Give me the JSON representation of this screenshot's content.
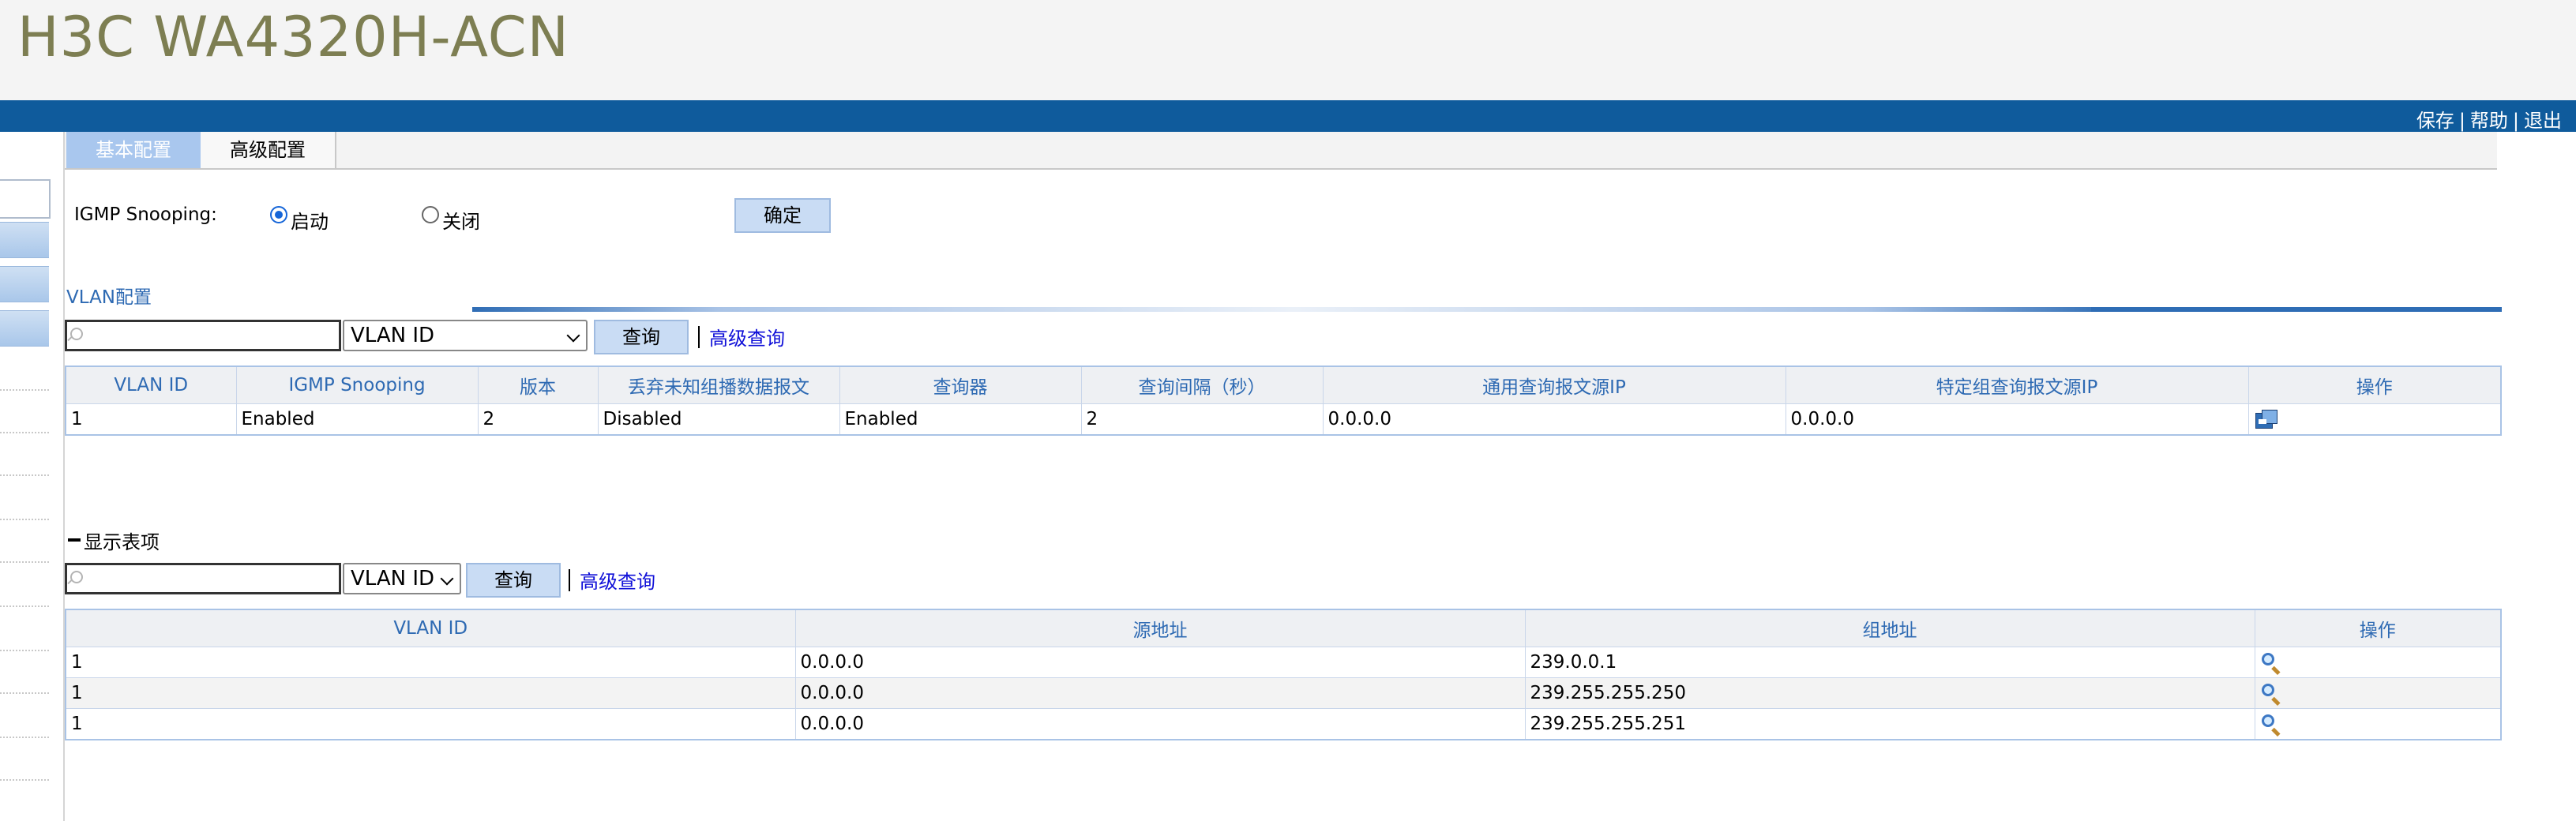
{
  "app": {
    "title": "H3C WA4320H-ACN"
  },
  "topbar": {
    "save": "保存",
    "help": "帮助",
    "logout": "退出",
    "sep": "|"
  },
  "tabs": [
    {
      "label": "基本配置",
      "active": true
    },
    {
      "label": "高级配置",
      "active": false
    }
  ],
  "snooping": {
    "label": "IGMP Snooping:",
    "enable_label": "启动",
    "disable_label": "关闭",
    "selected": "启动",
    "confirm_label": "确定"
  },
  "vlan_section": {
    "title": "VLAN配置",
    "search_placeholder": "",
    "select_value": "VLAN ID",
    "query_label": "查询",
    "advanced_label": "高级查询",
    "columns": [
      "VLAN ID",
      "IGMP Snooping",
      "版本",
      "丢弃未知组播数据报文",
      "查询器",
      "查询间隔（秒）",
      "通用查询报文源IP",
      "特定组查询报文源IP",
      "操作"
    ],
    "rows": [
      [
        "1",
        "Enabled",
        "2",
        "Disabled",
        "Enabled",
        "2",
        "0.0.0.0",
        "0.0.0.0"
      ]
    ]
  },
  "entries_section": {
    "title": "显示表项",
    "search_placeholder": "",
    "select_value": "VLAN ID",
    "query_label": "查询",
    "advanced_label": "高级查询",
    "columns": [
      "VLAN ID",
      "源地址",
      "组地址",
      "操作"
    ],
    "rows": [
      [
        "1",
        "0.0.0.0",
        "239.0.0.1"
      ],
      [
        "1",
        "0.0.0.0",
        "239.255.255.250"
      ],
      [
        "1",
        "0.0.0.0",
        "239.255.255.251"
      ]
    ]
  },
  "colors": {
    "title": "#7d7e52",
    "topbar": "#0f5b9c",
    "accent": "#2e6ab3",
    "link": "#1010d8"
  },
  "icons": {
    "edit": "edit-icon",
    "detail": "zoom-icon",
    "search": "search-icon"
  }
}
